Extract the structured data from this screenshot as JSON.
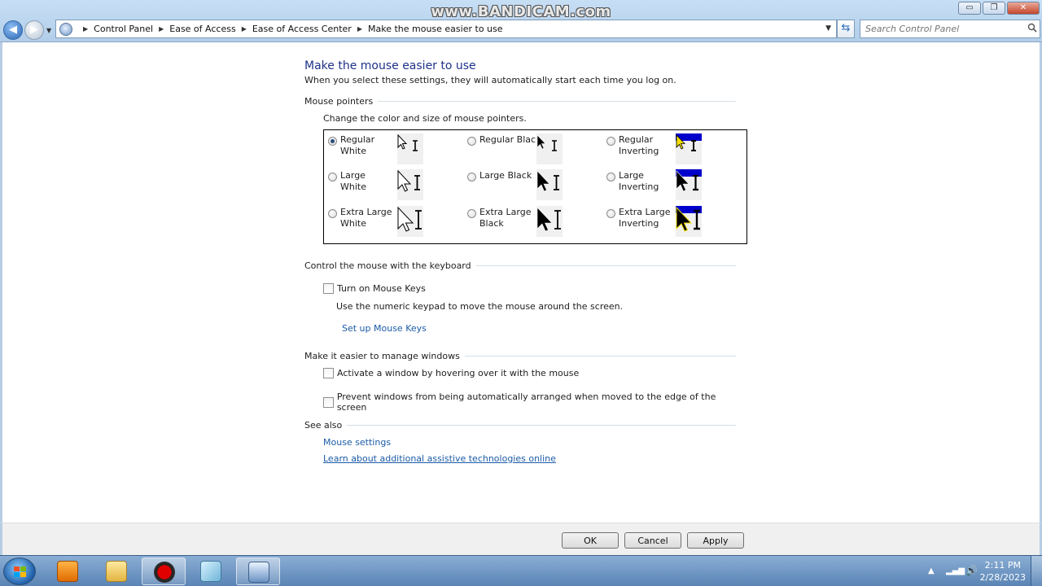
{
  "watermark": "www.BANDICAM.com",
  "window_controls": {
    "minimize": "▭",
    "maximize": "❐",
    "close": "✕"
  },
  "breadcrumb": [
    "Control Panel",
    "Ease of Access",
    "Ease of Access Center",
    "Make the mouse easier to use"
  ],
  "search": {
    "placeholder": "Search Control Panel"
  },
  "page": {
    "title": "Make the mouse easier to use",
    "intro": "When you select these settings, they will automatically start each time you log on."
  },
  "mouse_pointers": {
    "heading": "Mouse pointers",
    "subtext": "Change the color and size of mouse pointers.",
    "options": [
      {
        "label": "Regular White",
        "selected": true,
        "style": "white",
        "size": "regular"
      },
      {
        "label": "Regular Black",
        "selected": false,
        "style": "black",
        "size": "regular"
      },
      {
        "label": "Regular Inverting",
        "selected": false,
        "style": "inverting",
        "size": "regular"
      },
      {
        "label": "Large White",
        "selected": false,
        "style": "white",
        "size": "large"
      },
      {
        "label": "Large Black",
        "selected": false,
        "style": "black",
        "size": "large"
      },
      {
        "label": "Large Inverting",
        "selected": false,
        "style": "inverting",
        "size": "large"
      },
      {
        "label": "Extra Large White",
        "selected": false,
        "style": "white",
        "size": "xlarge"
      },
      {
        "label": "Extra Large Black",
        "selected": false,
        "style": "black",
        "size": "xlarge"
      },
      {
        "label": "Extra Large Inverting",
        "selected": false,
        "style": "inverting",
        "size": "xlarge"
      }
    ]
  },
  "keyboard": {
    "heading": "Control the mouse with the keyboard",
    "mouse_keys_label": "Turn on Mouse Keys",
    "mouse_keys_desc": "Use the numeric keypad to move the mouse around the screen.",
    "setup_link": "Set up Mouse Keys"
  },
  "windows": {
    "heading": "Make it easier to manage windows",
    "hover_label": "Activate a window by hovering over it with the mouse",
    "arrange_label": "Prevent windows from being automatically arranged when moved to the edge of the screen"
  },
  "see_also": {
    "heading": "See also",
    "mouse_settings": "Mouse settings",
    "learn_more": "Learn about additional assistive technologies online"
  },
  "buttons": {
    "ok": "OK",
    "cancel": "Cancel",
    "apply": "Apply"
  },
  "taskbar": {
    "time": "2:11 PM",
    "date": "2/28/2023"
  },
  "colors": {
    "title_blue": "#1e3287",
    "link_blue": "#1b5ba6",
    "inverting_blue": "#0000cc",
    "inverting_yellow": "#f5e000"
  }
}
